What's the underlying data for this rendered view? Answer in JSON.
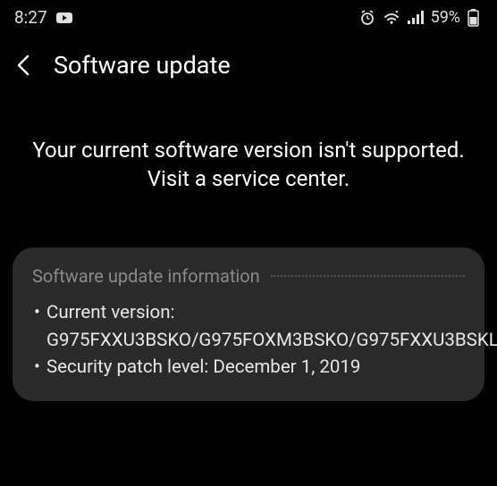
{
  "statusBar": {
    "time": "8:27",
    "batteryPercent": "59%"
  },
  "header": {
    "title": "Software update"
  },
  "message": {
    "text": "Your current software version isn't supported. Visit a service center."
  },
  "infoCard": {
    "title": "Software update information",
    "currentVersionLabel": "Current version: G975FXXU3BSKO/G975FOXM3BSKO/G975FXXU3BSKL",
    "securityPatchLabel": "Security patch level: December 1, 2019"
  }
}
